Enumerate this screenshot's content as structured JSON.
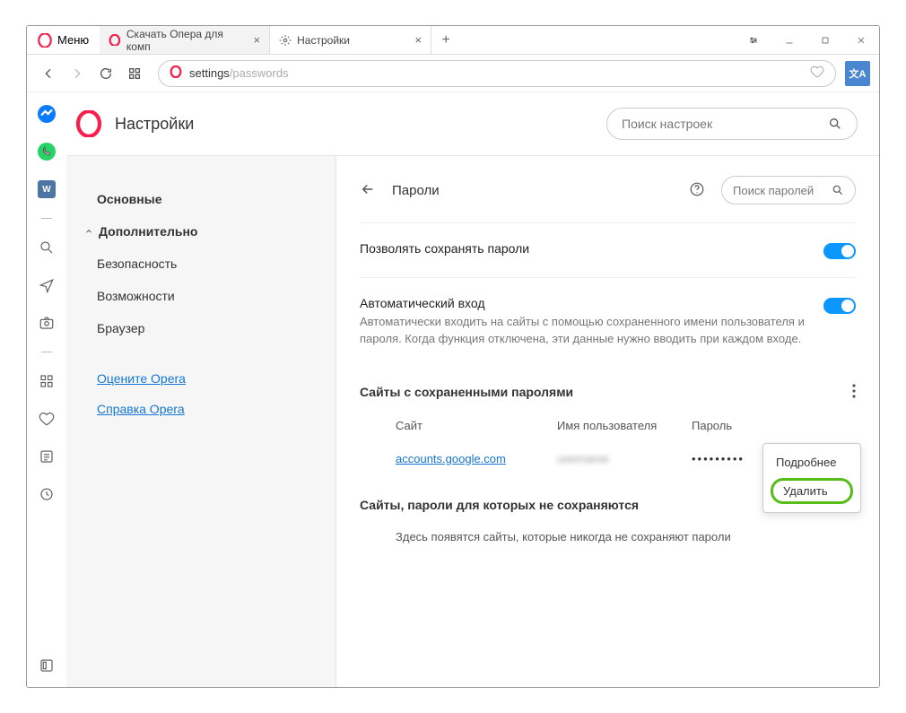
{
  "menu_label": "Меню",
  "tabs": [
    {
      "label": "Скачать Опера для комп",
      "active": false
    },
    {
      "label": "Настройки",
      "active": true
    }
  ],
  "address": {
    "prefix": "settings",
    "suffix": "/passwords"
  },
  "settings": {
    "title": "Настройки",
    "search_placeholder": "Поиск настроек"
  },
  "nav": {
    "basic": "Основные",
    "advanced": "Дополнительно",
    "security": "Безопасность",
    "features": "Возможности",
    "browser": "Браузер",
    "rate_link": "Оцените Opera",
    "help_link": "Справка Opera"
  },
  "passwords": {
    "heading": "Пароли",
    "search_placeholder": "Поиск паролей",
    "offer_save": "Позволять сохранять пароли",
    "auto_signin_title": "Автоматический вход",
    "auto_signin_desc": "Автоматически входить на сайты с помощью сохраненного имени пользователя и пароля. Когда функция отключена, эти данные нужно вводить при каждом входе.",
    "saved_title": "Сайты с сохраненными паролями",
    "col_site": "Сайт",
    "col_user": "Имя пользователя",
    "col_pass": "Пароль",
    "entry_site": "accounts.google.com",
    "entry_user_hidden": "username",
    "entry_dots": "•••••••••",
    "menu_details": "Подробнее",
    "menu_delete": "Удалить",
    "never_title": "Сайты, пароли для которых не сохраняются",
    "never_desc": "Здесь появятся сайты, которые никогда не сохраняют пароли"
  }
}
